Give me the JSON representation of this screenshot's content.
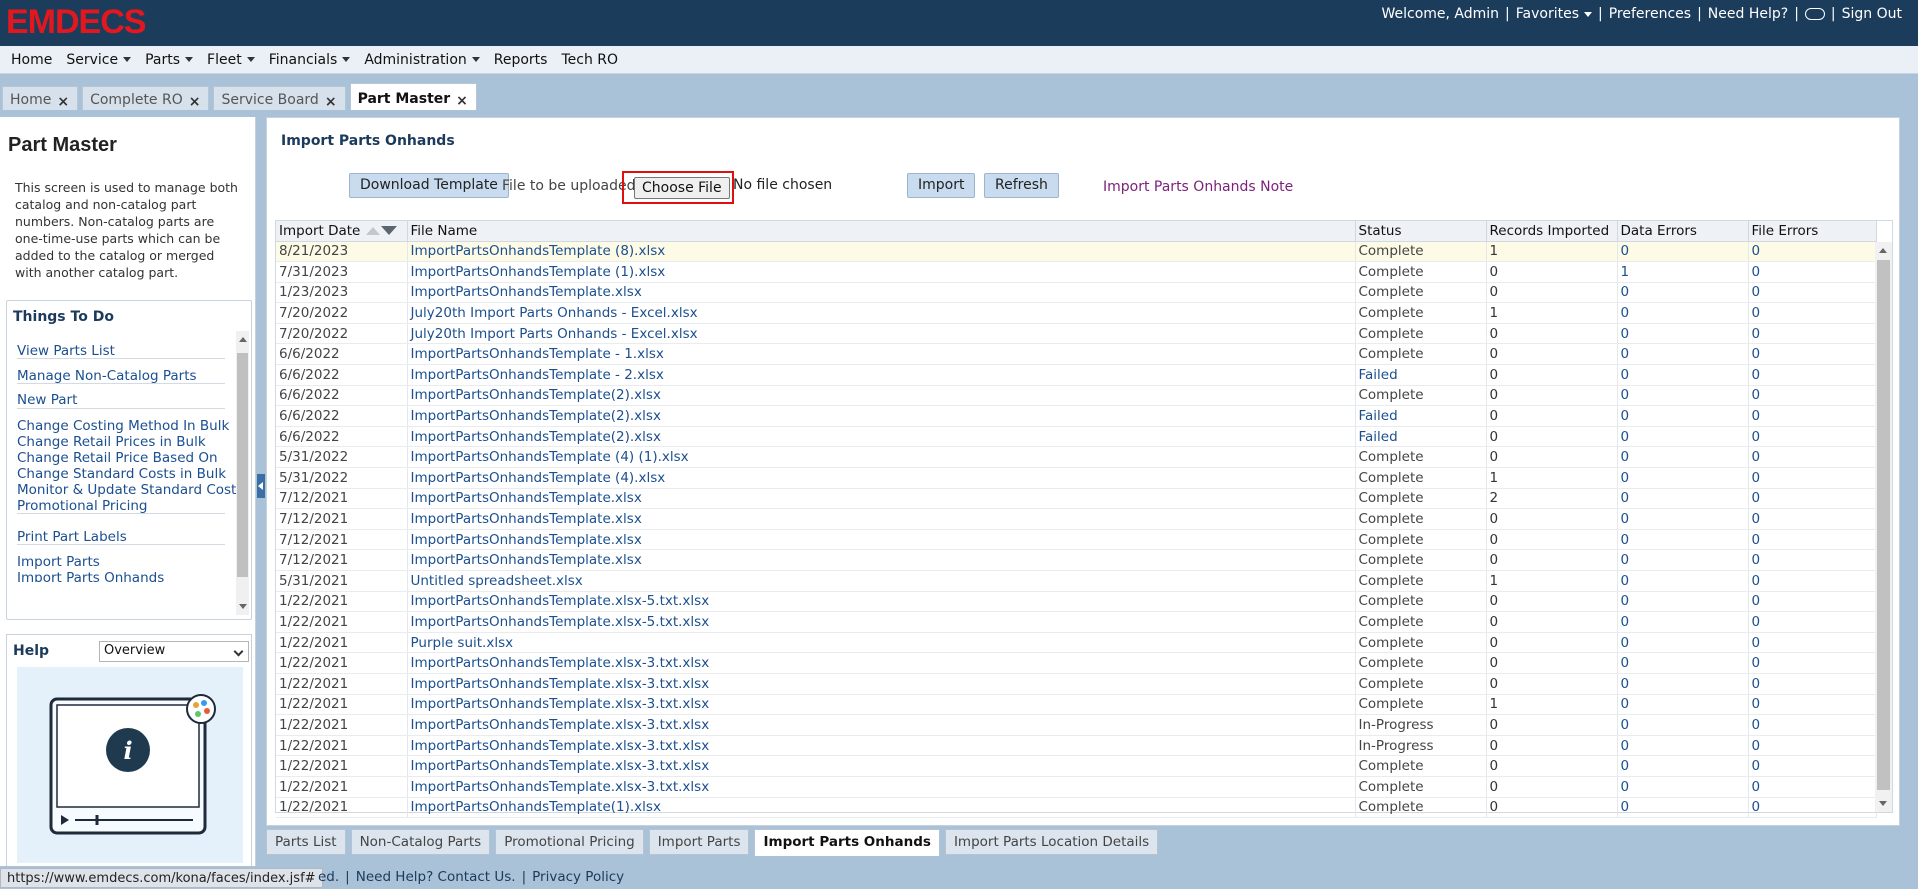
{
  "brand": {
    "logo_text": "EMDECS",
    "logo_color": "#e3181f"
  },
  "top_links": {
    "welcome": "Welcome, Admin",
    "favorites": "Favorites",
    "preferences": "Preferences",
    "need_help": "Need Help?",
    "sign_out": "Sign Out"
  },
  "menu": [
    "Home",
    "Service",
    "Parts",
    "Fleet",
    "Financials",
    "Administration",
    "Reports",
    "Tech RO"
  ],
  "menu_has_dropdown": [
    false,
    true,
    true,
    true,
    true,
    true,
    false,
    false
  ],
  "page_tabs": [
    {
      "label": "Home",
      "active": false
    },
    {
      "label": "Complete RO",
      "active": false
    },
    {
      "label": "Service Board",
      "active": false
    },
    {
      "label": "Part Master",
      "active": true
    }
  ],
  "sidebar": {
    "title": "Part Master",
    "description": "This screen is used to manage both catalog and non-catalog part numbers. Non-catalog parts are one-time-use parts which can be added to the catalog or merged with another catalog part.",
    "todo_title": "Things To Do",
    "todo_items": [
      "View Parts List",
      "Manage Non-Catalog Parts",
      "New Part",
      "Change Costing Method In Bulk",
      "Change Retail Prices in Bulk",
      "Change Retail Price Based On",
      "Change Standard Costs in Bulk",
      "Monitor & Update Standard Costs",
      "Promotional Pricing",
      "Print Part Labels",
      "Import Parts",
      "Import Parts Onhands"
    ],
    "help_title": "Help",
    "help_option": "Overview"
  },
  "panel": {
    "title": "Import Parts Onhands",
    "download_template": "Download Template",
    "file_label": "File to be uploaded",
    "choose_file": "Choose File",
    "no_file": "No file chosen",
    "import": "Import",
    "refresh": "Refresh",
    "note_link": "Import Parts Onhands Note"
  },
  "grid": {
    "columns": [
      "Import Date",
      "File Name",
      "Status",
      "Records Imported",
      "Data Errors",
      "File Errors"
    ],
    "rows": [
      [
        "8/21/2023",
        "ImportPartsOnhandsTemplate (8).xlsx",
        "Complete",
        "1",
        "0",
        "0"
      ],
      [
        "7/31/2023",
        "ImportPartsOnhandsTemplate (1).xlsx",
        "Complete",
        "0",
        "1",
        "0"
      ],
      [
        "1/23/2023",
        "ImportPartsOnhandsTemplate.xlsx",
        "Complete",
        "0",
        "0",
        "0"
      ],
      [
        "7/20/2022",
        "July20th Import Parts Onhands - Excel.xlsx",
        "Complete",
        "1",
        "0",
        "0"
      ],
      [
        "7/20/2022",
        "July20th Import Parts Onhands - Excel.xlsx",
        "Complete",
        "0",
        "0",
        "0"
      ],
      [
        "6/6/2022",
        "ImportPartsOnhandsTemplate - 1.xlsx",
        "Complete",
        "0",
        "0",
        "0"
      ],
      [
        "6/6/2022",
        "ImportPartsOnhandsTemplate - 2.xlsx",
        "Failed",
        "0",
        "0",
        "0"
      ],
      [
        "6/6/2022",
        "ImportPartsOnhandsTemplate(2).xlsx",
        "Complete",
        "0",
        "0",
        "0"
      ],
      [
        "6/6/2022",
        "ImportPartsOnhandsTemplate(2).xlsx",
        "Failed",
        "0",
        "0",
        "0"
      ],
      [
        "6/6/2022",
        "ImportPartsOnhandsTemplate(2).xlsx",
        "Failed",
        "0",
        "0",
        "0"
      ],
      [
        "5/31/2022",
        "ImportPartsOnhandsTemplate (4) (1).xlsx",
        "Complete",
        "0",
        "0",
        "0"
      ],
      [
        "5/31/2022",
        "ImportPartsOnhandsTemplate (4).xlsx",
        "Complete",
        "1",
        "0",
        "0"
      ],
      [
        "7/12/2021",
        "ImportPartsOnhandsTemplate.xlsx",
        "Complete",
        "2",
        "0",
        "0"
      ],
      [
        "7/12/2021",
        "ImportPartsOnhandsTemplate.xlsx",
        "Complete",
        "0",
        "0",
        "0"
      ],
      [
        "7/12/2021",
        "ImportPartsOnhandsTemplate.xlsx",
        "Complete",
        "0",
        "0",
        "0"
      ],
      [
        "7/12/2021",
        "ImportPartsOnhandsTemplate.xlsx",
        "Complete",
        "0",
        "0",
        "0"
      ],
      [
        "5/31/2021",
        "Untitled spreadsheet.xlsx",
        "Complete",
        "1",
        "0",
        "0"
      ],
      [
        "1/22/2021",
        "ImportPartsOnhandsTemplate.xlsx-5.txt.xlsx",
        "Complete",
        "0",
        "0",
        "0"
      ],
      [
        "1/22/2021",
        "ImportPartsOnhandsTemplate.xlsx-5.txt.xlsx",
        "Complete",
        "0",
        "0",
        "0"
      ],
      [
        "1/22/2021",
        "Purple suit.xlsx",
        "Complete",
        "0",
        "0",
        "0"
      ],
      [
        "1/22/2021",
        "ImportPartsOnhandsTemplate.xlsx-3.txt.xlsx",
        "Complete",
        "0",
        "0",
        "0"
      ],
      [
        "1/22/2021",
        "ImportPartsOnhandsTemplate.xlsx-3.txt.xlsx",
        "Complete",
        "0",
        "0",
        "0"
      ],
      [
        "1/22/2021",
        "ImportPartsOnhandsTemplate.xlsx-3.txt.xlsx",
        "Complete",
        "1",
        "0",
        "0"
      ],
      [
        "1/22/2021",
        "ImportPartsOnhandsTemplate.xlsx-3.txt.xlsx",
        "In-Progress",
        "0",
        "0",
        "0"
      ],
      [
        "1/22/2021",
        "ImportPartsOnhandsTemplate.xlsx-3.txt.xlsx",
        "In-Progress",
        "0",
        "0",
        "0"
      ],
      [
        "1/22/2021",
        "ImportPartsOnhandsTemplate.xlsx-3.txt.xlsx",
        "Complete",
        "0",
        "0",
        "0"
      ],
      [
        "1/22/2021",
        "ImportPartsOnhandsTemplate.xlsx-3.txt.xlsx",
        "Complete",
        "0",
        "0",
        "0"
      ],
      [
        "1/22/2021",
        "ImportPartsOnhandsTemplate(1).xlsx",
        "Complete",
        "0",
        "0",
        "0"
      ]
    ]
  },
  "sub_tabs": [
    {
      "label": "Parts List",
      "active": false
    },
    {
      "label": "Non-Catalog Parts",
      "active": false
    },
    {
      "label": "Promotional Pricing",
      "active": false
    },
    {
      "label": "Import Parts",
      "active": false
    },
    {
      "label": "Import Parts Onhands",
      "active": true
    },
    {
      "label": "Import Parts Location Details",
      "active": false
    }
  ],
  "footer": {
    "status_url": "https://www.emdecs.com/kona/faces/index.jsf#",
    "partial_text": "ed.",
    "help_link": "Need Help? Contact Us.",
    "privacy_link": "Privacy Policy"
  }
}
